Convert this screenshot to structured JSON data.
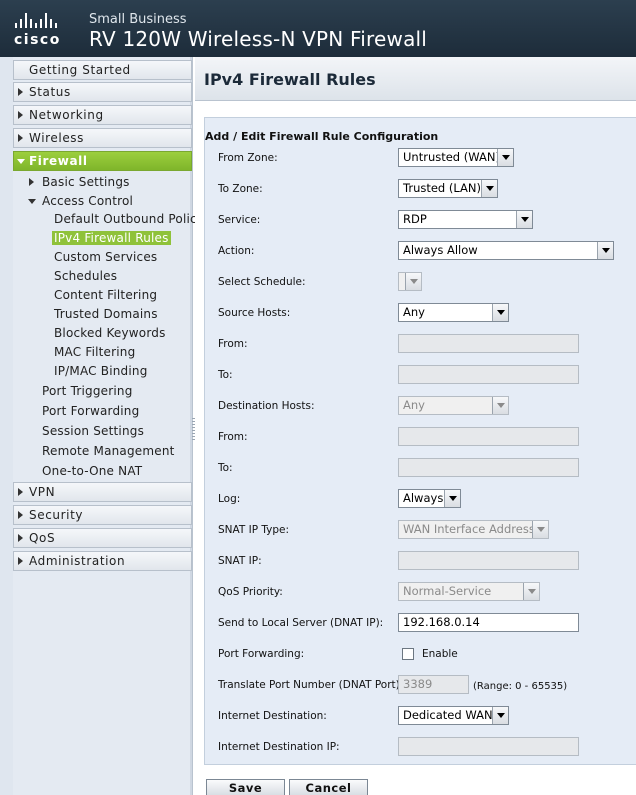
{
  "header": {
    "logo_text": "cisco",
    "brand_small": "Small Business",
    "title": "RV 120W Wireless-N VPN Firewall"
  },
  "sidebar": {
    "getting_started": "Getting Started",
    "status": "Status",
    "networking": "Networking",
    "wireless": "Wireless",
    "firewall": "Firewall",
    "basic_settings": "Basic Settings",
    "access_control": "Access Control",
    "default_outbound_policy": "Default Outbound Policy",
    "ipv4_firewall_rules": "IPv4 Firewall Rules",
    "custom_services": "Custom Services",
    "schedules": "Schedules",
    "content_filtering": "Content Filtering",
    "trusted_domains": "Trusted Domains",
    "blocked_keywords": "Blocked Keywords",
    "mac_filtering": "MAC Filtering",
    "ip_mac_binding": "IP/MAC Binding",
    "port_triggering": "Port Triggering",
    "port_forwarding": "Port Forwarding",
    "session_settings": "Session Settings",
    "remote_management": "Remote Management",
    "one_to_one_nat": "One-to-One NAT",
    "vpn": "VPN",
    "security": "Security",
    "qos": "QoS",
    "administration": "Administration"
  },
  "main": {
    "page_title": "IPv4 Firewall Rules",
    "section_title": "Add / Edit Firewall Rule Configuration",
    "labels": {
      "from_zone": "From Zone:",
      "to_zone": "To Zone:",
      "service": "Service:",
      "action": "Action:",
      "select_schedule": "Select Schedule:",
      "source_hosts": "Source Hosts:",
      "from1": "From:",
      "to1": "To:",
      "destination_hosts": "Destination Hosts:",
      "from2": "From:",
      "to2": "To:",
      "log": "Log:",
      "snat_ip_type": "SNAT IP Type:",
      "snat_ip": "SNAT IP:",
      "qos_priority": "QoS Priority:",
      "dnat_ip": "Send to Local Server (DNAT IP):",
      "port_forwarding": "Port Forwarding:",
      "dnat_port": "Translate Port Number (DNAT Port):",
      "internet_destination": "Internet Destination:",
      "internet_destination_ip": "Internet Destination IP:"
    },
    "values": {
      "from_zone": "Untrusted (WAN)",
      "to_zone": "Trusted (LAN)",
      "service": "RDP",
      "action": "Always Allow",
      "select_schedule": "",
      "source_hosts": "Any",
      "destination_hosts": "Any",
      "log": "Always",
      "snat_ip_type": "WAN Interface Address",
      "qos_priority": "Normal-Service",
      "dnat_ip": "192.168.0.14",
      "port_forwarding_enable": "Enable",
      "dnat_port": "3389",
      "dnat_port_range": "(Range: 0 - 65535)",
      "internet_destination": "Dedicated WAN"
    },
    "buttons": {
      "save": "Save",
      "cancel": "Cancel"
    }
  }
}
